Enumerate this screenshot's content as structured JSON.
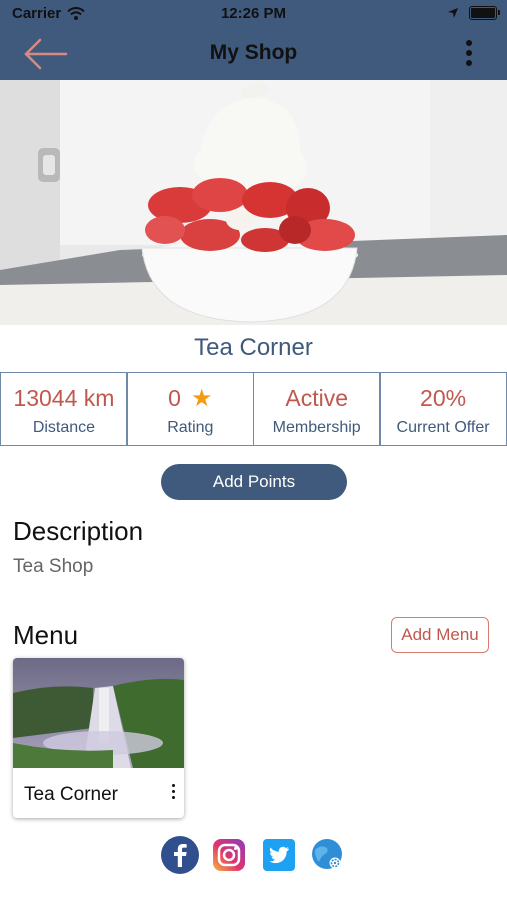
{
  "status": {
    "carrier": "Carrier",
    "time": "12:26 PM"
  },
  "header": {
    "title": "My Shop"
  },
  "shop": {
    "name": "Tea Corner"
  },
  "stats": [
    {
      "value": "13044 km",
      "label": "Distance"
    },
    {
      "value": "0",
      "label": "Rating",
      "icon": "star-icon"
    },
    {
      "value": "Active",
      "label": "Membership"
    },
    {
      "value": "20%",
      "label": "Current Offer"
    }
  ],
  "actions": {
    "add_points": "Add Points",
    "add_menu": "Add Menu"
  },
  "description": {
    "heading": "Description",
    "text": "Tea Shop"
  },
  "menu": {
    "heading": "Menu",
    "items": [
      {
        "name": "Tea Corner"
      }
    ]
  },
  "social": [
    "facebook-icon",
    "instagram-icon",
    "twitter-icon",
    "website-icon"
  ],
  "colors": {
    "brand": "#3f5a7c",
    "accent": "#c0584e",
    "star": "#f39c12"
  }
}
